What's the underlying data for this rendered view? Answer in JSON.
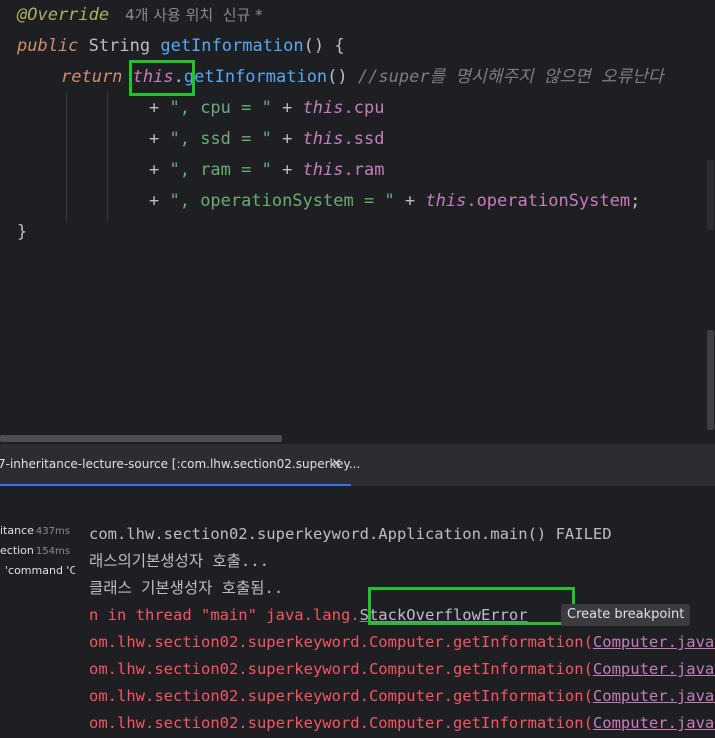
{
  "editor": {
    "annotation": "@Override",
    "hint": "4개 사용 위치  신규 *",
    "line_public": "public",
    "line_type": "String",
    "line_method": "getInformation",
    "line_paren": "() {",
    "return_kw": "return",
    "this_kw": "this",
    "dot": ".",
    "call": "getInformation",
    "call_paren": "()",
    "comment": "//super를 명시해주지 않으면 오류난다",
    "l3_plus": "+ ",
    "l3_str": "\", cpu = \"",
    "l3_plus2": " + ",
    "l3_this": "this",
    "l3_field": ".cpu",
    "l4_str": "\", ssd = \"",
    "l4_field": ".ssd",
    "l5_str": "\", ram = \"",
    "l5_field": ".ram",
    "l6_str": "\", operationSystem = \"",
    "l6_field": ".operationSystem",
    "l6_end": ";",
    "close_brace": "}"
  },
  "tabbar": {
    "tab_label": "7-inheritance-lecture-source [:com.lhw.section02.superkey...",
    "close": "×"
  },
  "tests": [
    {
      "name": "itance",
      "time": "437ms"
    },
    {
      "name": "ection",
      "time": "154ms"
    },
    {
      "name": "'command 'C",
      "time": ""
    }
  ],
  "console": {
    "line1": "com.lhw.section02.superkeyword.Application.main() FAILED",
    "line2": "래스의기본생성자 호출...",
    "line3": "클래스 기본생성자 호출됨..",
    "line4_prefix": "n in thread \"main\" java.lang.",
    "line4_error": "StackOverflowError",
    "tooltip": "Create breakpoint",
    "stack_prefix": "om.lhw.section02.superkeyword.Computer.getInformation(",
    "stack_link": "Computer.java:",
    "stack_count": 4
  }
}
